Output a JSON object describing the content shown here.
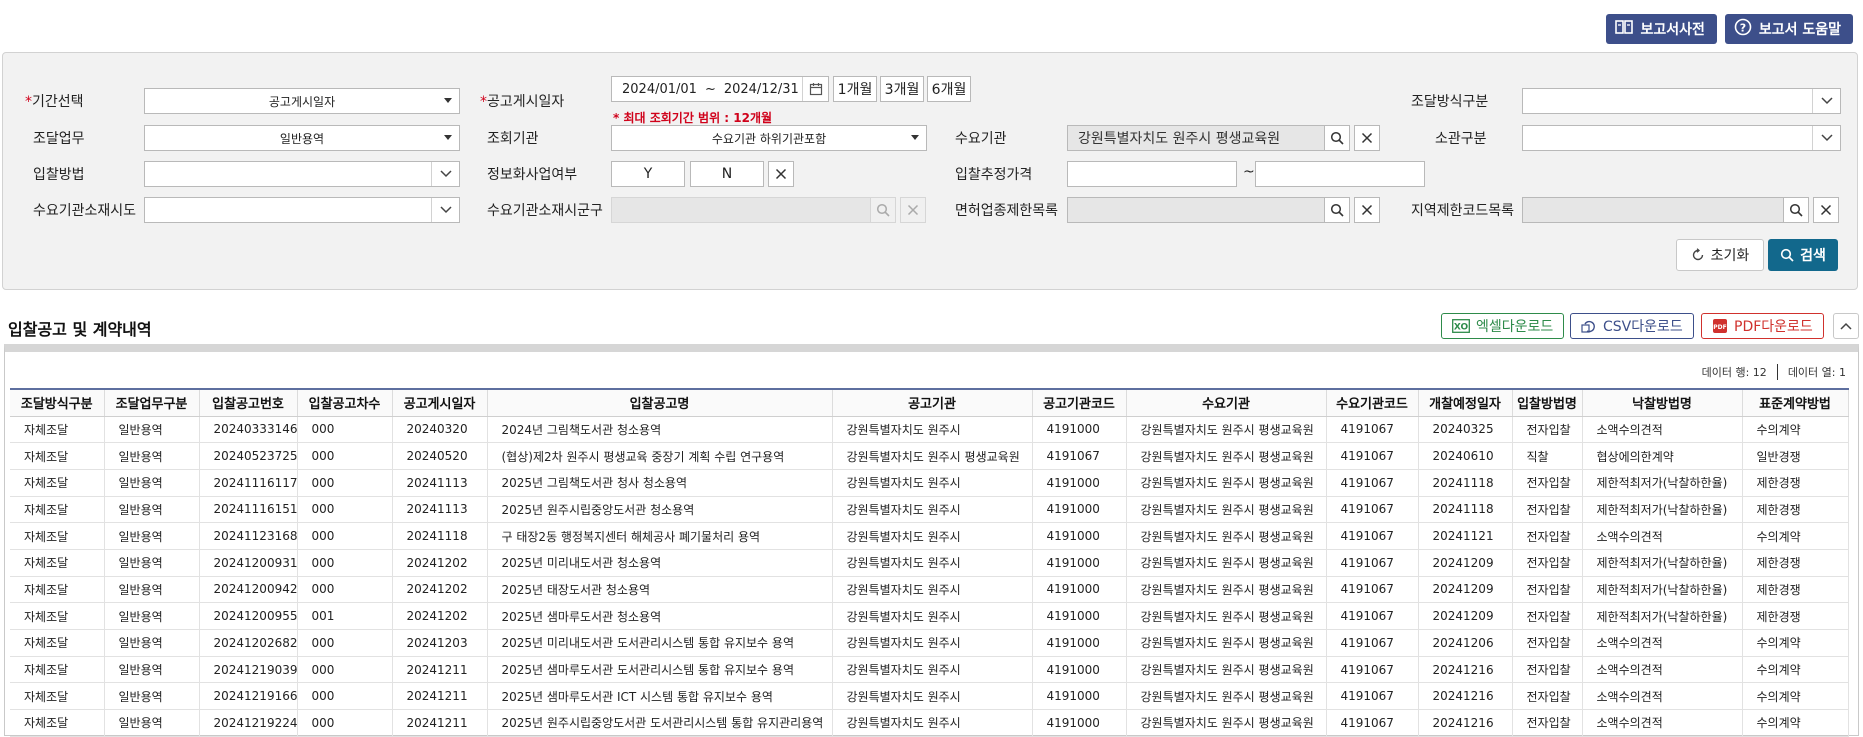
{
  "header": {
    "dictionary_label": "보고서사전",
    "help_label": "보고서 도움말"
  },
  "search": {
    "period_label": "기간선택",
    "period_value": "공고게시일자",
    "notice_date_label": "공고게시일자",
    "date_from": "2024/01/01",
    "date_sep": "~",
    "date_to": "2024/12/31",
    "range_1m": "1개월",
    "range_3m": "3개월",
    "range_6m": "6개월",
    "max_range_warning": "* 최대 조회기간 범위 : 12개월",
    "procure_method_label": "조달방식구분",
    "procure_method_value": "",
    "task_label": "조달업무",
    "task_value": "일반용역",
    "query_org_label": "조회기관",
    "query_org_value": "수요기관 하위기관포함",
    "demand_org_label": "수요기관",
    "demand_org_value": "강원특별자치도 원주시 평생교육원",
    "jurisdiction_label": "소관구분",
    "jurisdiction_value": "",
    "bid_method_label": "입찰방법",
    "bid_method_value": "",
    "info_biz_label": "정보화사업여부",
    "info_biz_yes": "Y",
    "info_biz_no": "N",
    "est_price_label": "입찰추정가격",
    "est_price_from": "",
    "est_price_sep": "~",
    "est_price_to": "",
    "org_sido_label": "수요기관소재시도",
    "org_sido_value": "",
    "org_sigungu_label": "수요기관소재시군구",
    "license_label": "면허업종제한목록",
    "region_label": "지역제한코드목록",
    "reset_label": "초기화",
    "search_label": "검색"
  },
  "results": {
    "title": "입찰공고 및 계약내역",
    "excel_label": "엑셀다운로드",
    "csv_label": "CSV다운로드",
    "pdf_label": "PDF다운로드",
    "row_count_label": "데이터 행: 12",
    "col_count_label": "데이터 열: 1",
    "columns": [
      "조달방식구분",
      "조달업무구분",
      "입찰공고번호",
      "입찰공고차수",
      "공고게시일자",
      "입찰공고명",
      "공고기관",
      "공고기관코드",
      "수요기관",
      "수요기관코드",
      "개찰예정일자",
      "입찰방법명",
      "낙찰방법명",
      "표준계약방법"
    ],
    "rows": [
      [
        "자체조달",
        "일반용역",
        "20240333146",
        "000",
        "20240320",
        "2024년 그림책도서관 청소용역",
        "강원특별자치도 원주시",
        "4191000",
        "강원특별자치도 원주시 평생교육원",
        "4191067",
        "20240325",
        "전자입찰",
        "소액수의견적",
        "수의계약"
      ],
      [
        "자체조달",
        "일반용역",
        "20240523725",
        "000",
        "20240520",
        "(협상)제2차 원주시 평생교육 중장기 계획 수립 연구용역",
        "강원특별자치도 원주시 평생교육원",
        "4191067",
        "강원특별자치도 원주시 평생교육원",
        "4191067",
        "20240610",
        "직찰",
        "협상에의한계약",
        "일반경쟁"
      ],
      [
        "자체조달",
        "일반용역",
        "20241116117",
        "000",
        "20241113",
        "2025년 그림책도서관 청사 청소용역",
        "강원특별자치도 원주시",
        "4191000",
        "강원특별자치도 원주시 평생교육원",
        "4191067",
        "20241118",
        "전자입찰",
        "제한적최저가(낙찰하한율)",
        "제한경쟁"
      ],
      [
        "자체조달",
        "일반용역",
        "20241116151",
        "000",
        "20241113",
        "2025년 원주시립중앙도서관 청소용역",
        "강원특별자치도 원주시",
        "4191000",
        "강원특별자치도 원주시 평생교육원",
        "4191067",
        "20241118",
        "전자입찰",
        "제한적최저가(낙찰하한율)",
        "제한경쟁"
      ],
      [
        "자체조달",
        "일반용역",
        "20241123168",
        "000",
        "20241118",
        "구 태장2동 행정복지센터 해체공사 폐기물처리 용역",
        "강원특별자치도 원주시",
        "4191000",
        "강원특별자치도 원주시 평생교육원",
        "4191067",
        "20241121",
        "전자입찰",
        "소액수의견적",
        "수의계약"
      ],
      [
        "자체조달",
        "일반용역",
        "20241200931",
        "000",
        "20241202",
        "2025년 미리내도서관 청소용역",
        "강원특별자치도 원주시",
        "4191000",
        "강원특별자치도 원주시 평생교육원",
        "4191067",
        "20241209",
        "전자입찰",
        "제한적최저가(낙찰하한율)",
        "제한경쟁"
      ],
      [
        "자체조달",
        "일반용역",
        "20241200942",
        "000",
        "20241202",
        "2025년 태장도서관 청소용역",
        "강원특별자치도 원주시",
        "4191000",
        "강원특별자치도 원주시 평생교육원",
        "4191067",
        "20241209",
        "전자입찰",
        "제한적최저가(낙찰하한율)",
        "제한경쟁"
      ],
      [
        "자체조달",
        "일반용역",
        "20241200955",
        "001",
        "20241202",
        "2025년 샘마루도서관 청소용역",
        "강원특별자치도 원주시",
        "4191000",
        "강원특별자치도 원주시 평생교육원",
        "4191067",
        "20241209",
        "전자입찰",
        "제한적최저가(낙찰하한율)",
        "제한경쟁"
      ],
      [
        "자체조달",
        "일반용역",
        "20241202682",
        "000",
        "20241203",
        "2025년 미리내도서관 도서관리시스템 통합 유지보수 용역",
        "강원특별자치도 원주시",
        "4191000",
        "강원특별자치도 원주시 평생교육원",
        "4191067",
        "20241206",
        "전자입찰",
        "소액수의견적",
        "수의계약"
      ],
      [
        "자체조달",
        "일반용역",
        "20241219039",
        "000",
        "20241211",
        "2025년 샘마루도서관 도서관리시스템 통합 유지보수 용역",
        "강원특별자치도 원주시",
        "4191000",
        "강원특별자치도 원주시 평생교육원",
        "4191067",
        "20241216",
        "전자입찰",
        "소액수의견적",
        "수의계약"
      ],
      [
        "자체조달",
        "일반용역",
        "20241219166",
        "000",
        "20241211",
        "2025년 샘마루도서관 ICT 시스템 통합 유지보수 용역",
        "강원특별자치도 원주시",
        "4191000",
        "강원특별자치도 원주시 평생교육원",
        "4191067",
        "20241216",
        "전자입찰",
        "소액수의견적",
        "수의계약"
      ],
      [
        "자체조달",
        "일반용역",
        "20241219224",
        "000",
        "20241211",
        "2025년 원주시립중앙도서관 도서관리시스템 통합 유지관리용역",
        "강원특별자치도 원주시",
        "4191000",
        "강원특별자치도 원주시 평생교육원",
        "4191067",
        "20241216",
        "전자입찰",
        "소액수의견적",
        "수의계약"
      ]
    ]
  }
}
